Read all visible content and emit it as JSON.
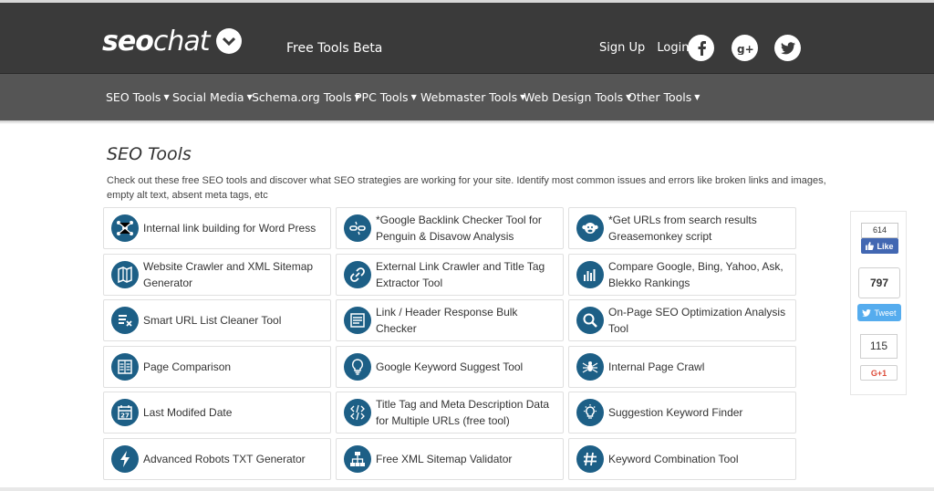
{
  "header": {
    "logo_text_bold": "seo",
    "logo_text_rest": "chat",
    "tagline": "Free Tools Beta",
    "sign_up": "Sign Up",
    "login": "Login",
    "social": [
      {
        "name": "facebook-icon",
        "glyph": "f"
      },
      {
        "name": "google-plus-icon",
        "glyph": "g+"
      },
      {
        "name": "twitter-icon",
        "glyph": "t"
      }
    ]
  },
  "nav": {
    "items": [
      {
        "label": "SEO Tools"
      },
      {
        "label": "Social Media"
      },
      {
        "label": "Schema.org Tools"
      },
      {
        "label": "PPC Tools"
      },
      {
        "label": "Webmaster Tools"
      },
      {
        "label": "Web Design Tools"
      },
      {
        "label": "Other Tools"
      }
    ]
  },
  "main": {
    "title": "SEO Tools",
    "intro": "Check out these free SEO tools and discover what SEO strategies are working for your site. Identify most common issues and errors like broken links and images, empty alt text, absent meta tags, etc",
    "tools": [
      {
        "label": "Internal link building for Word Press",
        "icon": "network-icon"
      },
      {
        "label": "*Google Backlink Checker Tool for Penguin & Disavow Analysis",
        "icon": "link-broken-icon"
      },
      {
        "label": "*Get URLs from search results Greasemonkey script",
        "icon": "monkey-icon"
      },
      {
        "label": "Website Crawler and XML Sitemap Generator",
        "icon": "map-icon"
      },
      {
        "label": "External Link Crawler and Title Tag Extractor Tool",
        "icon": "link-icon"
      },
      {
        "label": "Compare Google, Bing, Yahoo, Ask, Blekko Rankings",
        "icon": "bar-chart-icon"
      },
      {
        "label": "Smart URL List Cleaner Tool",
        "icon": "list-clean-icon"
      },
      {
        "label": "Link / Header Response Bulk Checker",
        "icon": "list-check-icon"
      },
      {
        "label": "On-Page SEO Optimization Analysis Tool",
        "icon": "magnifier-icon"
      },
      {
        "label": "Page Comparison",
        "icon": "columns-icon"
      },
      {
        "label": "Google Keyword Suggest Tool",
        "icon": "lightbulb-icon"
      },
      {
        "label": "Internal Page Crawl",
        "icon": "spider-icon"
      },
      {
        "label": "Last Modifed Date",
        "icon": "calendar-icon",
        "badge": "27"
      },
      {
        "label": "Title Tag and Meta Description Data for Multiple URLs (free tool)",
        "icon": "code-tags-icon"
      },
      {
        "label": "Suggestion Keyword Finder",
        "icon": "idea-bulb-icon"
      },
      {
        "label": "Advanced Robots TXT Generator",
        "icon": "lightning-icon"
      },
      {
        "label": "Free XML Sitemap Validator",
        "icon": "sitemap-icon"
      },
      {
        "label": "Keyword Combination Tool",
        "icon": "hashtag-icon"
      }
    ]
  },
  "share": {
    "fb_count": "614",
    "fb_label": "Like",
    "tw_count": "797",
    "tw_label": "Tweet",
    "gp_count": "115",
    "gp_label": "G+1"
  },
  "colors": {
    "topbar": "#3a3a3a",
    "navbar": "#555555",
    "icon_accent": "#1d5f86",
    "facebook": "#4267b2",
    "twitter": "#55acee",
    "google": "#dd4b39"
  }
}
